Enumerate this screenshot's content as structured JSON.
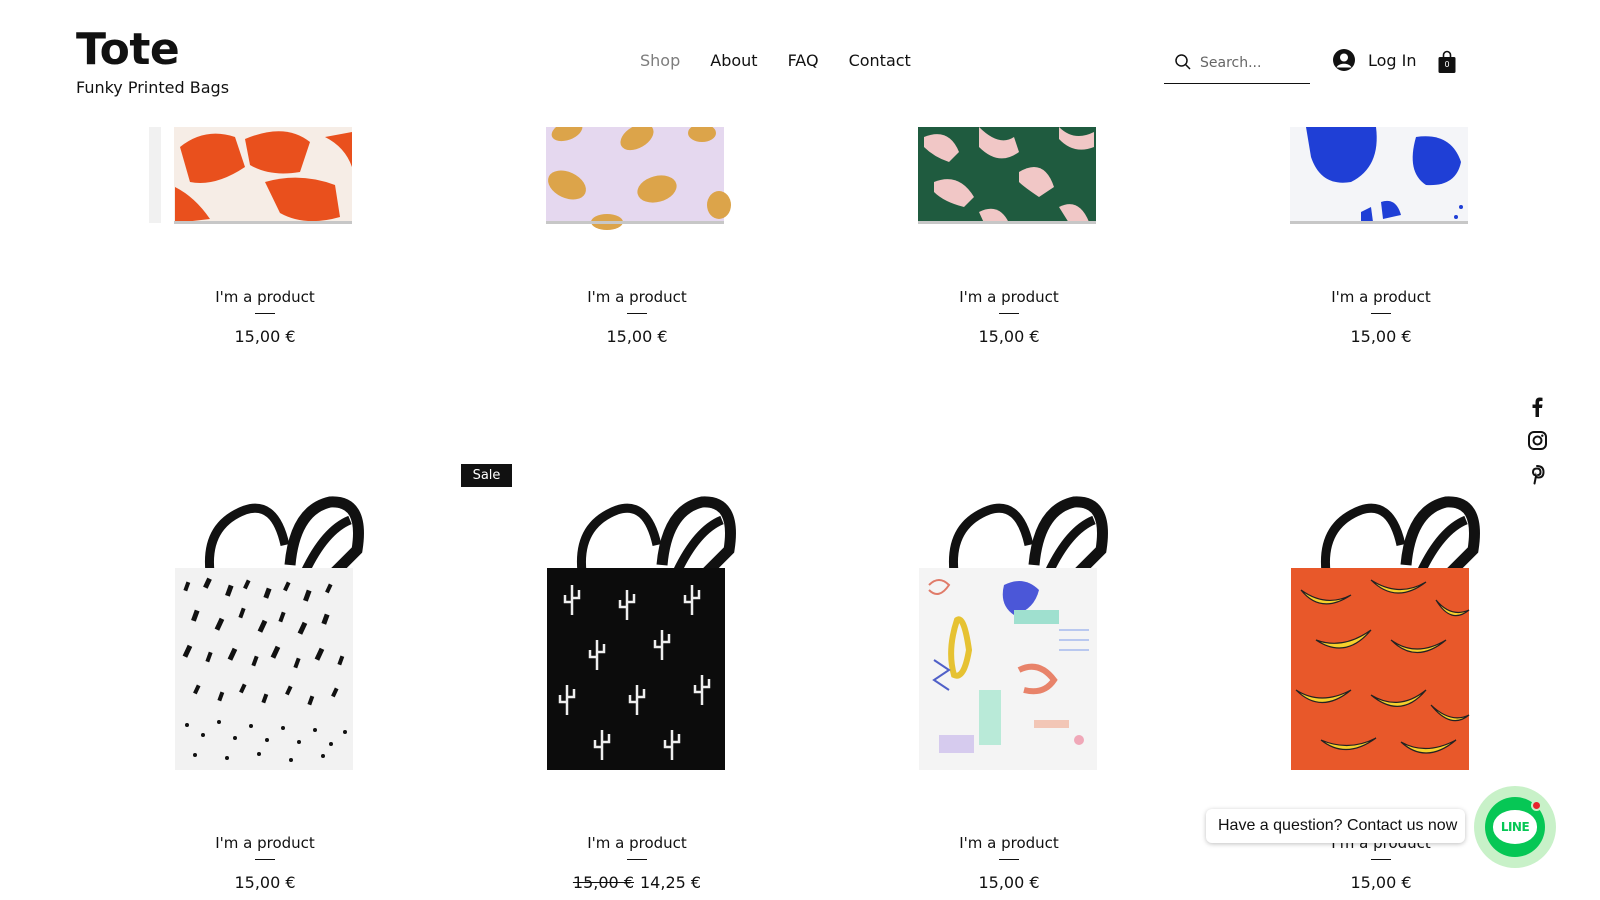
{
  "brand": {
    "title": "Tote",
    "subtitle": "Funky Printed Bags"
  },
  "nav": {
    "items": [
      "Shop",
      "About",
      "FAQ",
      "Contact"
    ],
    "active": "Shop"
  },
  "search": {
    "placeholder": "Search..."
  },
  "account": {
    "login_label": "Log In"
  },
  "cart": {
    "count": "0"
  },
  "products": [
    {
      "name": "I'm a product",
      "price": "15,00 €",
      "pattern": "orange-brush"
    },
    {
      "name": "I'm a product",
      "price": "15,00 €",
      "pattern": "lemons-on-lilac"
    },
    {
      "name": "I'm a product",
      "price": "15,00 €",
      "pattern": "hands-on-green"
    },
    {
      "name": "I'm a product",
      "price": "15,00 €",
      "pattern": "blue-blobs"
    },
    {
      "name": "I'm a product",
      "price": "15,00 €",
      "pattern": "black-dots"
    },
    {
      "name": "I'm a product",
      "price": "15,00 €",
      "sale_price": "14,25 €",
      "badge": "Sale",
      "pattern": "cactus-on-black"
    },
    {
      "name": "I'm a product",
      "price": "15,00 €",
      "pattern": "abstract-pastel"
    },
    {
      "name": "I'm a product",
      "price": "15,00 €",
      "pattern": "bananas-on-orange"
    }
  ],
  "social": [
    "facebook-icon",
    "instagram-icon",
    "pinterest-icon"
  ],
  "chat": {
    "prompt": "Have a question? Contact us now",
    "button_label": "LINE"
  }
}
